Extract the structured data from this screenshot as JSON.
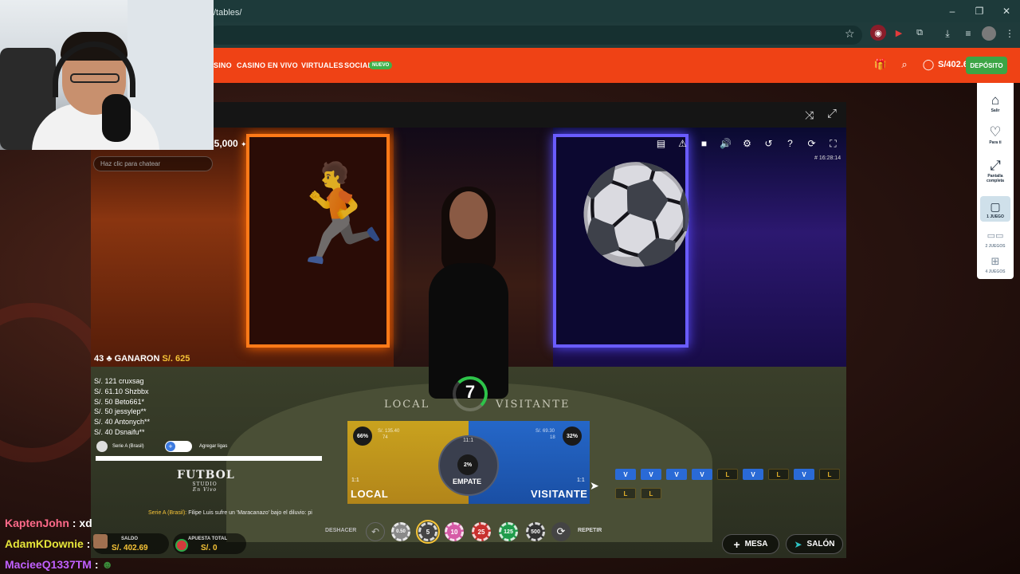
{
  "browser": {
    "url": "/tables/",
    "window_controls": [
      "–",
      "❐",
      "✕"
    ]
  },
  "nav": {
    "links": [
      "SINO",
      "CASINO EN VIVO",
      "VIRTUALES",
      "SOCIAL"
    ],
    "badge": "NUEVO",
    "balance": "S/402.69",
    "deposit": "DEPÓSITO"
  },
  "game": {
    "limits": "25,000",
    "chat_placeholder": "Haz clic para chatear",
    "game_id": "# 16:28:14",
    "winners": {
      "count": "43",
      "label": "GANARON",
      "amount": "S/. 625"
    },
    "winner_list": [
      "S/. 121  cruxsag",
      "S/. 61.10  Shzbbx",
      "S/. 50  Beto661*",
      "S/. 50  jessylep**",
      "S/. 40  Antonych**",
      "S/. 40  Dsnaifu**"
    ],
    "league": {
      "name": "Serie A (Brasil)",
      "add": "Agregar ligas"
    },
    "logo": {
      "main": "FUTBOL",
      "sub": "STUDIO",
      "script": "En Vivo"
    },
    "ticker": {
      "tag": "Serie A (Brasil):",
      "text": " Filipe Luis sufre un 'Maracanazo' bajo el diluvio: pi"
    },
    "table_text": {
      "local": "LOCAL",
      "visitante": "VISITANTE"
    },
    "timer": "7",
    "bets": {
      "local": {
        "label": "LOCAL",
        "pct": "66%",
        "stake": "S/. 135.40",
        "count": "74",
        "odds": "1:1"
      },
      "visitante": {
        "label": "VISITANTE",
        "pct": "32%",
        "stake": "S/. 69.30",
        "count": "18",
        "odds": "1:1"
      },
      "empate": {
        "label": "EMPATE",
        "pct": "2%",
        "odds": "11:1"
      }
    },
    "road_row_1": [
      "V",
      "V",
      "V",
      "V",
      "L",
      "V",
      "L",
      "V",
      "L"
    ],
    "road_row_2": [
      "L",
      "L"
    ]
  },
  "controls": {
    "saldo_label": "SALDO",
    "saldo_value": "S/. 402.69",
    "total_label": "APUESTA TOTAL",
    "total_value": "S/. 0",
    "undo": "DESHACER",
    "chips": [
      "0.50",
      "5",
      "10",
      "25",
      "125",
      "500"
    ],
    "repeat": "REPETIR",
    "mesa": "MESA",
    "salon": "SALÓN"
  },
  "sidebar": [
    {
      "icon": "home-icon",
      "label": "Salir"
    },
    {
      "icon": "heart-icon",
      "label": "Para ti"
    },
    {
      "icon": "fullscreen-icon",
      "label": "Pantalla completa"
    },
    {
      "icon": "single-game-icon",
      "label": "1 JUEGO"
    },
    {
      "icon": "two-games-icon",
      "label": "2 JUEGOS"
    },
    {
      "icon": "four-games-icon",
      "label": "4 JUEGOS"
    }
  ],
  "stream_chat": [
    {
      "user": "KaptenJohn",
      "msg": " : xd"
    },
    {
      "user": "AdamKDownie",
      "msg": " :"
    },
    {
      "user": "MacieeQ1337TM",
      "msg": " :"
    }
  ],
  "colors": {
    "nav_bg": "#ef4215",
    "deposit_green": "#3ca545",
    "local_gold": "#c9a21e",
    "visit_blue": "#2567c8",
    "timer_green": "#2ec44a"
  }
}
